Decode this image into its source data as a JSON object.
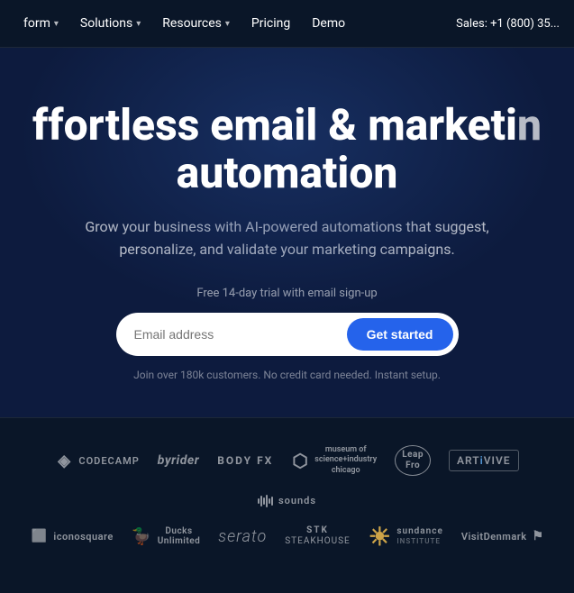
{
  "navbar": {
    "platform_label": "form",
    "platform_chevron": "▾",
    "solutions_label": "Solutions",
    "solutions_chevron": "▾",
    "resources_label": "Resources",
    "resources_chevron": "▾",
    "pricing_label": "Pricing",
    "demo_label": "Demo",
    "sales_label": "Sales: +1 (800) 35..."
  },
  "hero": {
    "title_line1": "ffortless email & marketi",
    "title_suffix": "n",
    "title_line2": "automation",
    "subtitle": "Grow your business with AI-powered automations that suggest, personalize, and validate your marketing campaigns.",
    "trial_label": "Free 14-day trial with email sign-up",
    "email_placeholder": "Email address",
    "cta_button": "Get started",
    "disclaimer": "Join over 180k customers. No credit card needed. Instant setup."
  },
  "logos_row1": [
    {
      "name": "codecamp",
      "icon": "◈",
      "text": "CODECAMP",
      "style": "codecamp"
    },
    {
      "name": "byrider",
      "icon": "",
      "text": "byrider",
      "style": "byrider"
    },
    {
      "name": "bodyfx",
      "icon": "",
      "text": "BODY FX",
      "style": "bodyfx"
    },
    {
      "name": "museum",
      "icon": "⬡",
      "text": "museum of\nscience+industry\nchicago",
      "style": "museum"
    },
    {
      "name": "leapfrog",
      "icon": "",
      "text": "Leap\nFro",
      "style": "leapfrog"
    },
    {
      "name": "artivive",
      "icon": "",
      "text": "ARTIVIVE",
      "style": "artivive"
    },
    {
      "name": "sounds",
      "icon": "waveform",
      "text": "sounds",
      "style": "sounds"
    }
  ],
  "logos_row2": [
    {
      "name": "iconosquare",
      "icon": "⬜",
      "text": "iconosquare",
      "style": "iconosquare"
    },
    {
      "name": "ducks-unlimited",
      "icon": "🦆",
      "text": "Ducks\nUnlimited",
      "style": "ducks"
    },
    {
      "name": "serato",
      "icon": "",
      "text": "serato",
      "style": "serato"
    },
    {
      "name": "stk",
      "icon": "",
      "text": "STK STEAKHOUSE",
      "style": "stk"
    },
    {
      "name": "sundance",
      "icon": "☀",
      "text": "sundance",
      "style": "sundance"
    },
    {
      "name": "visitdenmark",
      "icon": "⚑",
      "text": "VisitDenmark",
      "style": "visitdenmark"
    }
  ]
}
